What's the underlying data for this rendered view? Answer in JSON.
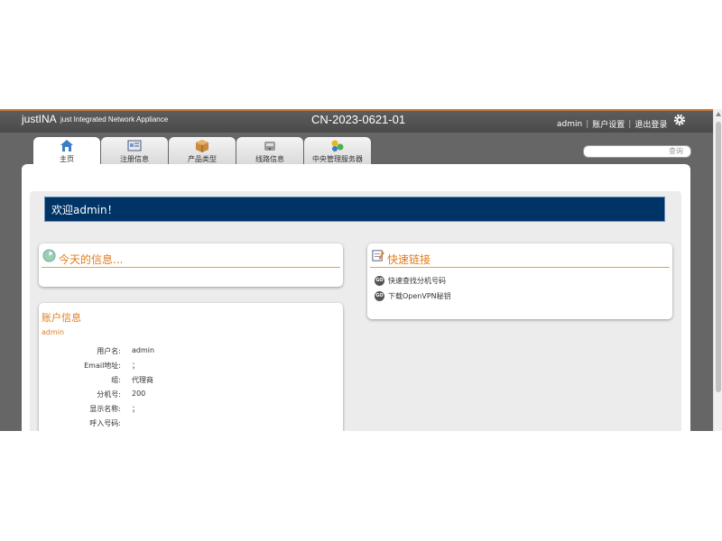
{
  "header": {
    "brand": "justINA",
    "brand_sub": "just Integrated Network Appliance",
    "device_id": "CN-2023-0621-01",
    "user": "admin",
    "account_settings": "账户设置",
    "logout": "退出登录",
    "separator": "|"
  },
  "tabs": [
    {
      "label": "主页",
      "icon": "home-icon",
      "active": true
    },
    {
      "label": "注册信息",
      "icon": "registration-icon"
    },
    {
      "label": "产品类型",
      "icon": "box-icon"
    },
    {
      "label": "线路信息",
      "icon": "phone-icon"
    },
    {
      "label": "中央管理服务器",
      "icon": "server-icon"
    }
  ],
  "search": {
    "label": "查询"
  },
  "welcome": "欢迎admin！",
  "today": {
    "title": "今天的信息..."
  },
  "quick_links": {
    "title": "快速链接",
    "go_label": "GO",
    "items": [
      "快速查找分机号码",
      "下载OpenVPN秘钥"
    ]
  },
  "account": {
    "title": "账户信息",
    "username_display": "admin",
    "rows": [
      {
        "label": "用户名:",
        "value": "admin"
      },
      {
        "label": "Email地址:",
        "value": "；"
      },
      {
        "label": "组:",
        "value": "代理商"
      },
      {
        "label": "分机号:",
        "value": "200"
      },
      {
        "label": "显示名称:",
        "value": "；"
      },
      {
        "label": "呼入号码:",
        "value": ""
      }
    ]
  },
  "colors": {
    "accent": "#e07b1c",
    "welcome_bg": "#003366",
    "header_bg": "#555555"
  }
}
